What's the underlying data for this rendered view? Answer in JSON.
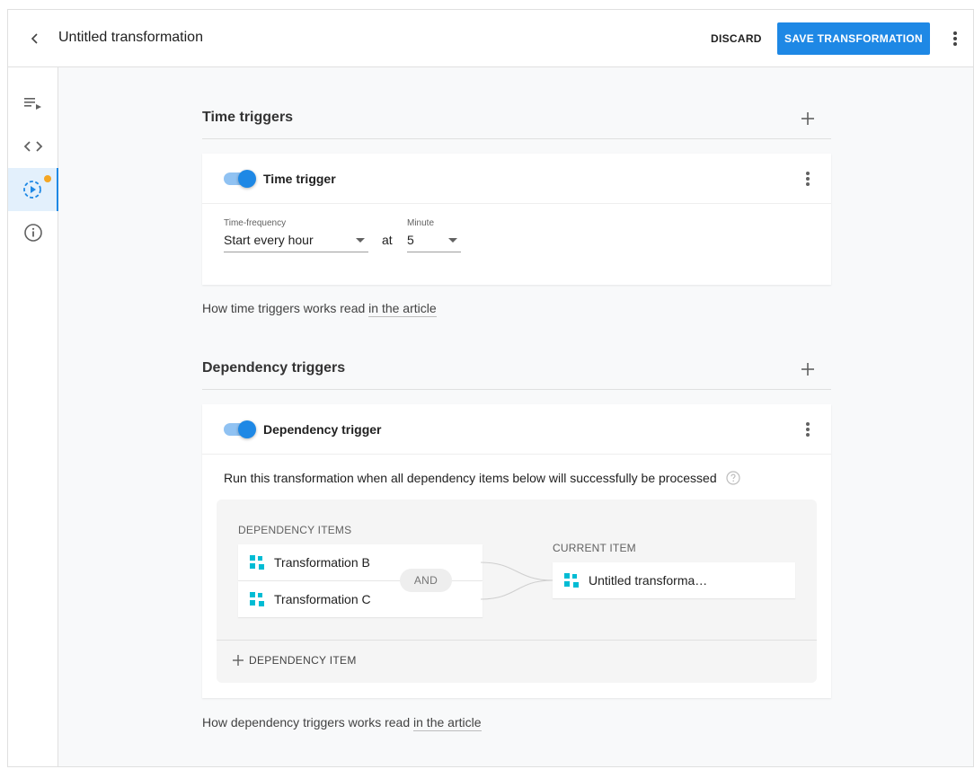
{
  "header": {
    "title": "Untitled transformation",
    "discard_label": "DISCARD",
    "save_label": "SAVE TRANSFORMATION",
    "back_icon": "chevron-left-icon",
    "more_icon": "more-vert-icon"
  },
  "sidebar": {
    "items": [
      {
        "icon": "playlist-play-icon",
        "active": false
      },
      {
        "icon": "code-icon",
        "active": false
      },
      {
        "icon": "trigger-icon",
        "active": true,
        "has_notification": true
      },
      {
        "icon": "info-icon",
        "active": false
      }
    ]
  },
  "time_triggers": {
    "section_title": "Time triggers",
    "card": {
      "title": "Time trigger",
      "enabled": true,
      "frequency_label": "Time-frequency",
      "frequency_value": "Start every hour",
      "at_label": "at",
      "minute_label": "Minute",
      "minute_value": "5"
    },
    "help_prefix": "How time triggers works read ",
    "help_link": "in the article"
  },
  "dependency_triggers": {
    "section_title": "Dependency triggers",
    "card": {
      "title": "Dependency trigger",
      "enabled": true,
      "description": "Run this transformation when all dependency items below will successfully be processed",
      "dependency_items_label": "DEPENDENCY ITEMS",
      "items": [
        "Transformation B",
        "Transformation C"
      ],
      "and_label": "AND",
      "current_item_label": "CURRENT ITEM",
      "current_item": "Untitled transforma…",
      "add_item_label": "DEPENDENCY ITEM"
    },
    "help_prefix": "How dependency triggers works read ",
    "help_link": "in the article"
  },
  "colors": {
    "accent": "#1e88e5",
    "toggle_track": "#90c2f2",
    "notification": "#f5a623",
    "item_icon": "#00bcd4"
  }
}
